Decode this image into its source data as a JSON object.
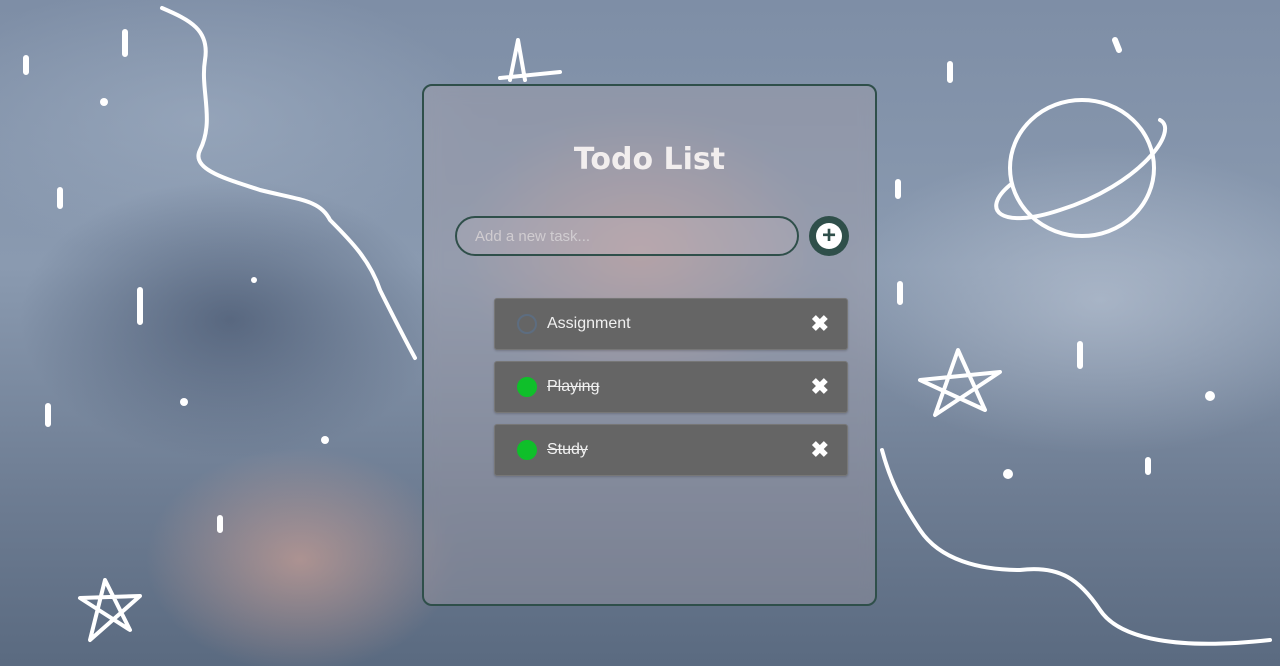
{
  "app": {
    "title": "Todo List"
  },
  "input": {
    "placeholder": "Add a new task...",
    "value": ""
  },
  "add_button": {
    "icon": "plus-circle-icon",
    "label": "+"
  },
  "tasks": [
    {
      "text": "Assignment",
      "done": false,
      "delete_label": "✖"
    },
    {
      "text": "Playing",
      "done": true,
      "delete_label": "✖"
    },
    {
      "text": "Study",
      "done": true,
      "delete_label": "✖"
    }
  ],
  "colors": {
    "accent": "#2f4f4a",
    "done": "#0fbf2a",
    "item_bg": "#656565"
  }
}
